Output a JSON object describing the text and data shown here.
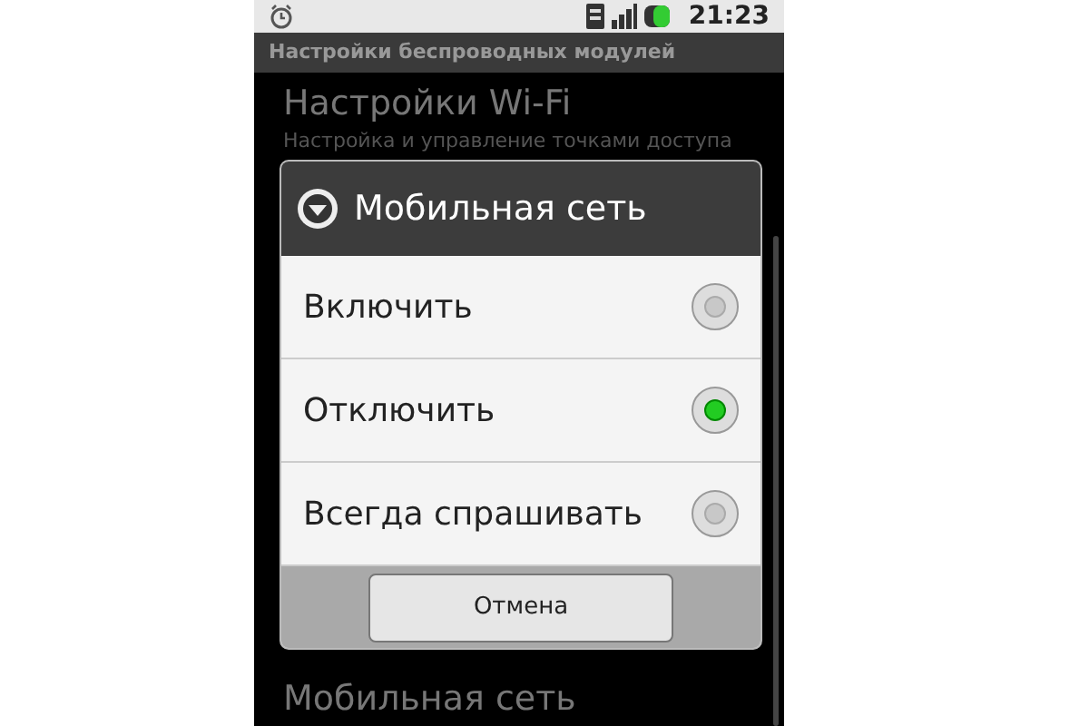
{
  "status_bar": {
    "time": "21:23"
  },
  "title_bar": {
    "title": "Настройки беспроводных модулей"
  },
  "settings": [
    {
      "title": "Настройки Wi-Fi",
      "summary": "Настройка и управление точками доступа"
    },
    {
      "title": "Мобильная сеть"
    }
  ],
  "dialog": {
    "title": "Мобильная сеть",
    "options": [
      {
        "label": "Включить",
        "selected": false
      },
      {
        "label": "Отключить",
        "selected": true
      },
      {
        "label": "Всегда спрашивать",
        "selected": false
      }
    ],
    "buttons": [
      "Отмена"
    ]
  }
}
